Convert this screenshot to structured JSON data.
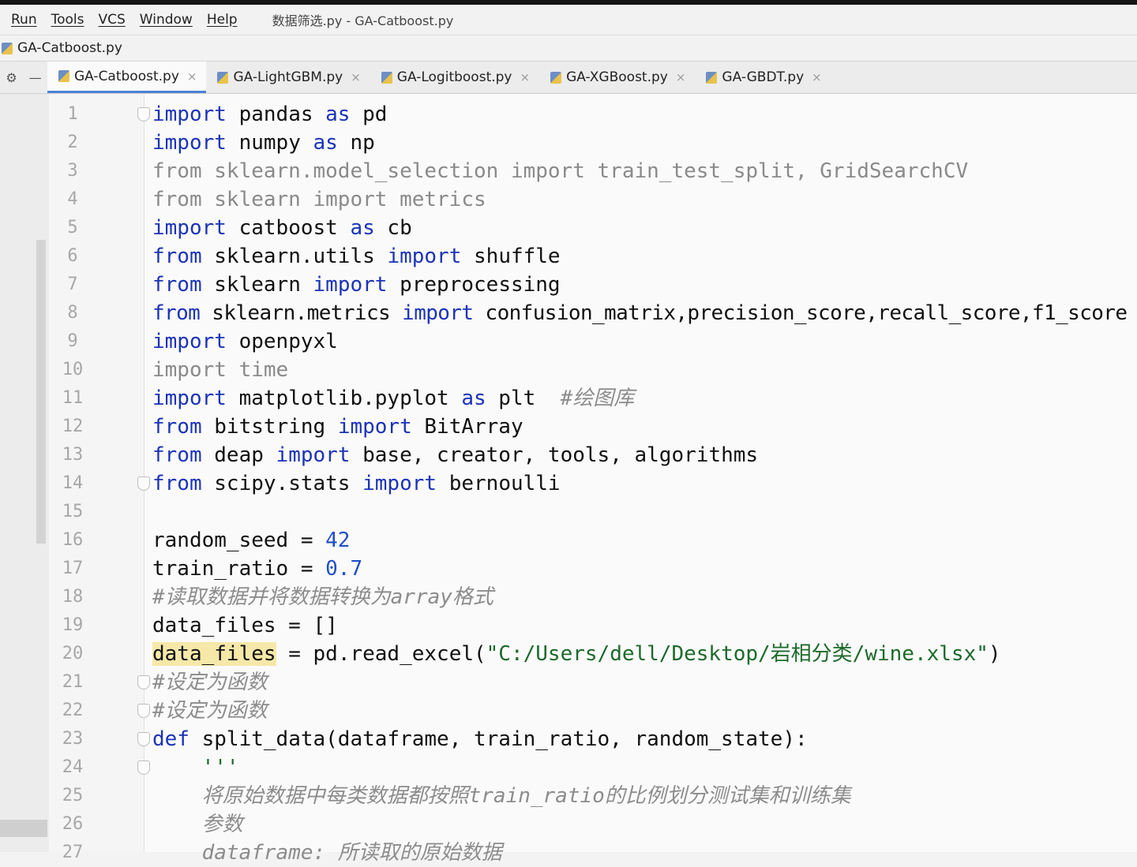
{
  "menu": {
    "items": [
      "Run",
      "Tools",
      "VCS",
      "Window",
      "Help"
    ],
    "window_title": "数据筛选.py - GA-Catboost.py"
  },
  "navbar": {
    "file": "GA-Catboost.py"
  },
  "tabs": [
    {
      "label": "GA-Catboost.py",
      "close": "×"
    },
    {
      "label": "GA-LightGBM.py",
      "close": "×"
    },
    {
      "label": "GA-Logitboost.py",
      "close": "×"
    },
    {
      "label": "GA-XGBoost.py",
      "close": "×"
    },
    {
      "label": "GA-GBDT.py",
      "close": "×"
    }
  ],
  "tab_tools": {
    "settings": "⚙",
    "collapse": "—"
  },
  "editor": {
    "active_tab_index": 0,
    "lines": [
      {
        "n": "1"
      },
      {
        "n": "2"
      },
      {
        "n": "3"
      },
      {
        "n": "4"
      },
      {
        "n": "5"
      },
      {
        "n": "6"
      },
      {
        "n": "7"
      },
      {
        "n": "8"
      },
      {
        "n": "9"
      },
      {
        "n": "10"
      },
      {
        "n": "11"
      },
      {
        "n": "12"
      },
      {
        "n": "13"
      },
      {
        "n": "14"
      },
      {
        "n": "15"
      },
      {
        "n": "16"
      },
      {
        "n": "17"
      },
      {
        "n": "18"
      },
      {
        "n": "19"
      },
      {
        "n": "20"
      },
      {
        "n": "21"
      },
      {
        "n": "22"
      },
      {
        "n": "23"
      },
      {
        "n": "24"
      },
      {
        "n": "25"
      },
      {
        "n": "26"
      },
      {
        "n": "27"
      }
    ],
    "code": {
      "l1": [
        "import",
        " pandas ",
        "as",
        " pd"
      ],
      "l2": [
        "import",
        " numpy ",
        "as",
        " np"
      ],
      "l3": "from sklearn.model_selection import train_test_split, GridSearchCV",
      "l4": "from sklearn import metrics",
      "l5": [
        "import",
        " catboost ",
        "as",
        " cb"
      ],
      "l6": [
        "from",
        " sklearn.utils ",
        "import",
        " shuffle"
      ],
      "l7": [
        "from",
        " sklearn ",
        "import",
        " preprocessing"
      ],
      "l8": [
        "from",
        " sklearn.metrics ",
        "import",
        " confusion_matrix,precision_score,recall_score,f1_score"
      ],
      "l9": [
        "import",
        " openpyxl"
      ],
      "l10": "import time",
      "l11": [
        "import",
        " matplotlib.pyplot ",
        "as",
        " plt  ",
        "#绘图库"
      ],
      "l12": [
        "from",
        " bitstring ",
        "import",
        " BitArray"
      ],
      "l13": [
        "from",
        " deap ",
        "import",
        " base, creator, tools, algorithms"
      ],
      "l14": [
        "from",
        " scipy.stats ",
        "import",
        " bernoulli"
      ],
      "l16": [
        "random_seed = ",
        "42"
      ],
      "l17": [
        "train_ratio = ",
        "0.7"
      ],
      "l18": "#读取数据并将数据转换为array格式",
      "l19": "data_files = []",
      "l20": [
        "data_files",
        " = pd.read_excel(",
        "\"C:/Users/dell/Desktop/岩相分类/wine.xlsx\"",
        ")"
      ],
      "l21": "#设定为函数",
      "l22": "#设定为函数",
      "l23": [
        "def",
        " split_data(dataframe, train_ratio, random_state):"
      ],
      "l24": "    '''",
      "l25": "    将原始数据中每类数据都按照train_ratio的比例划分测试集和训练集",
      "l26": "    参数",
      "l27": "    dataframe: 所读取的原始数据"
    }
  }
}
